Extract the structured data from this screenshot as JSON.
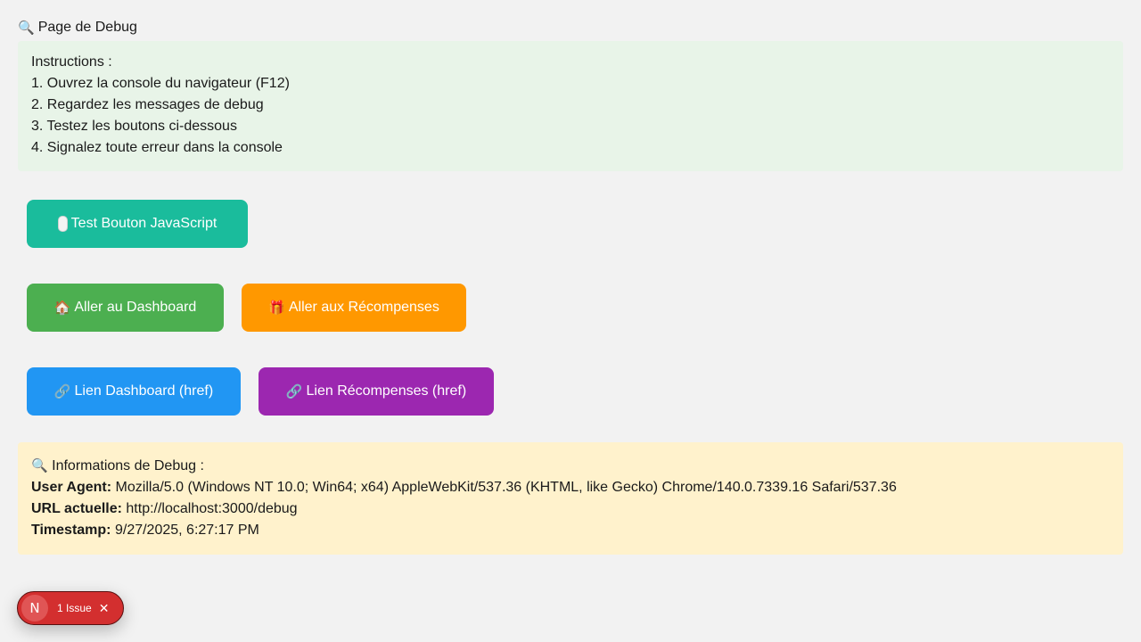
{
  "page": {
    "title": "Page de Debug",
    "title_icon": "magnifier-icon"
  },
  "instructions": {
    "heading": "Instructions :",
    "items": [
      "1. Ouvrez la console du navigateur (F12)",
      "2. Regardez les messages de debug",
      "3. Testez les boutons ci-dessous",
      "4. Signalez toute erreur dans la console"
    ]
  },
  "buttons": {
    "test_js": "Test Bouton JavaScript",
    "dashboard": "Aller au Dashboard",
    "rewards": "Aller aux Récompenses",
    "link_dashboard": "Lien Dashboard (href)",
    "link_rewards": "Lien Récompenses (href)"
  },
  "debug_info": {
    "heading": "Informations de Debug :",
    "user_agent_label": "User Agent:",
    "user_agent": "Mozilla/5.0 (Windows NT 10.0; Win64; x64) AppleWebKit/537.36 (KHTML, like Gecko) Chrome/140.0.7339.16 Safari/537.36",
    "url_label": "URL actuelle:",
    "url": "http://localhost:3000/debug",
    "timestamp_label": "Timestamp:",
    "timestamp": "9/27/2025, 6:27:17 PM"
  },
  "issue_badge": {
    "logo": "N",
    "label": "1 Issue"
  },
  "colors": {
    "background": "#f2f2f2",
    "instructions_bg": "#e8f4e8",
    "debug_bg": "#fff2cc",
    "test_button": "#1abc9c",
    "dashboard_button": "#4caf50",
    "rewards_button": "#ff9800",
    "link_dashboard_button": "#2196f3",
    "link_rewards_button": "#9c27b0",
    "issue_badge": "#d32f2f"
  }
}
